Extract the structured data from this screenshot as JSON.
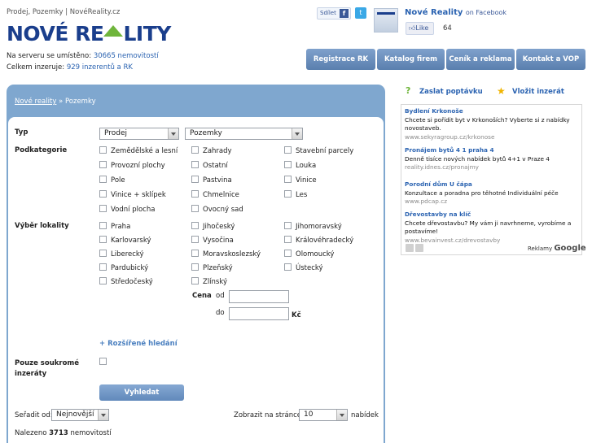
{
  "header": {
    "breadcrumb": "Prodej, Pozemky | NovéReality.cz",
    "logo_a": "NOVÉ RE",
    "logo_b": "LITY",
    "stats_line1_prefix": "Na serveru se umístěno: ",
    "stats_line1_link": "30665 nemovitostí",
    "stats_line2_prefix": "Celkem inzeruje: ",
    "stats_line2_link": "929 inzerentů a RK"
  },
  "social": {
    "share_label": "Sdílet",
    "fb_page_title": "Nové Reality",
    "fb_page_suffix": "on Facebook",
    "like_label": "Like",
    "like_count": "64"
  },
  "nav": [
    {
      "label": "Registrace RK"
    },
    {
      "label": "Katalog firem"
    },
    {
      "label": "Ceník a reklama"
    },
    {
      "label": "Kontakt a VOP"
    }
  ],
  "form": {
    "crumb_home": "Nové reality",
    "crumb_sep": " » ",
    "crumb_current": "Pozemky",
    "typ_label": "Typ",
    "typ_value": "Prodej",
    "typ2_value": "Pozemky",
    "podkategorie_label": "Podkategorie",
    "podkategorie": [
      "Zemědělské a lesní",
      "Zahrady",
      "Stavební parcely",
      "Provozní plochy",
      "Ostatní",
      "Louka",
      "Pole",
      "Pastvina",
      "Vinice",
      "Vinice + sklípek",
      "Chmelnice",
      "Les",
      "Vodní plocha",
      "Ovocný sad"
    ],
    "lokalita_label": "Výběr lokality",
    "lokality": [
      "Praha",
      "Jihočeský",
      "Jihomoravský",
      "Karlovarský",
      "Vysočina",
      "Královéhradecký",
      "Liberecký",
      "Moravskoslezský",
      "Olomoucký",
      "Pardubický",
      "Plzeňský",
      "Ústecký",
      "Středočeský",
      "Zlínský"
    ],
    "cena_label": "Cena",
    "od_label": "od",
    "do_label": "do",
    "currency": "Kč",
    "advanced_link": "+ Rozšířené hledání",
    "private_label_1": "Pouze soukromé",
    "private_label_2": "inzeráty",
    "search_button": "Vyhledat",
    "sort_label": "Seřadit od:",
    "sort_value": "Nejnovější",
    "per_page_label": "Zobrazit na stránce",
    "per_page_value": "10",
    "per_page_suffix": "nabídek",
    "found_prefix": "Nalezeno ",
    "found_count": "3713",
    "found_suffix": " nemovitostí"
  },
  "sidebar": {
    "ask_label": "Zaslat poptávku",
    "add_label": "Vložit inzerát",
    "ads": [
      {
        "title": "Bydlení Krkonoše",
        "desc": "Chcete si pořídit byt v Krkonoších? Vyberte si z nabídky novostaveb.",
        "url": "www.sekyragroup.cz/krkonose"
      },
      {
        "title": "Pronájem bytů 4 1 praha 4",
        "desc": "Denně tisíce nových nabídek bytů 4+1 v Praze 4",
        "url": "reality.idnes.cz/pronajmy"
      },
      {
        "title": "Porodní dům U čápa",
        "desc": "Konzultace a poradna pro těhotné Individuální péče",
        "url": "www.pdcap.cz"
      },
      {
        "title": "Dřevostavby na klíč",
        "desc": "Chcete dřevostavbu? My vám ji navrhneme, vyrobíme a postavíme!",
        "url": "www.bevainvest.cz/drevostavby"
      }
    ],
    "ads_by": "Reklamy",
    "ads_brand": "Google"
  },
  "colors": {
    "accent": "#2b63b1",
    "panel": "#7fa7cf",
    "logo_green": "#6fb53b"
  }
}
